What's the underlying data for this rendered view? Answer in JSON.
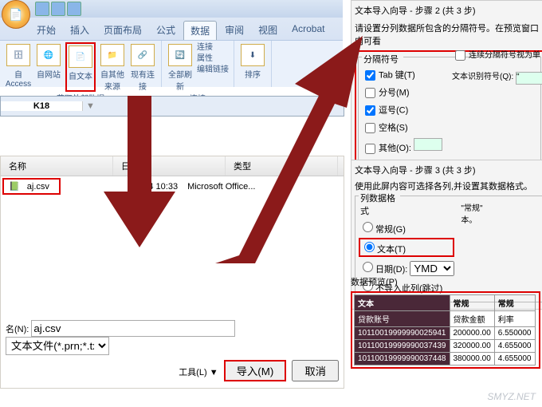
{
  "ribbon": {
    "tabs": [
      "开始",
      "插入",
      "页面布局",
      "公式",
      "数据",
      "审阅",
      "视图",
      "Acrobat"
    ],
    "active": 4,
    "group1": {
      "btns": [
        "自 Access",
        "自网站",
        "自文本",
        "自其他来源"
      ],
      "label": "获取外部数据"
    },
    "group1b": {
      "btn": "现有连接"
    },
    "group2": {
      "btn": "全部刷新",
      "items": [
        "连接",
        "属性",
        "编辑链接"
      ],
      "label": "连接"
    },
    "group3": {
      "btn": "排序"
    }
  },
  "namebox": {
    "cell": "K18"
  },
  "fileopen": {
    "headers": [
      "名称",
      "日期",
      "类型"
    ],
    "row": {
      "name": "aj.csv",
      "date": "0/3/14 10:33",
      "type": "Microsoft Office..."
    },
    "namelabel": "名(N):",
    "filter": "文本文件(*.prn;*.txt;*.csv)",
    "tools": "工具(L)",
    "import": "导入(M)",
    "cancel": "取消"
  },
  "wiz2": {
    "title": "文本导入向导 - 步骤 2 (共 3 步)",
    "desc": "请设置分列数据所包含的分隔符号。在预览窗口内可看",
    "fs": "分隔符号",
    "opts": [
      "Tab 键(T)",
      "分号(M)",
      "逗号(C)",
      "空格(S)",
      "其他(O):"
    ],
    "checked": [
      true,
      false,
      true,
      false,
      false
    ],
    "chain": "连续分隔符号视为单",
    "txtid": "文本识别符号(Q):",
    "prev": "数据预览(P)"
  },
  "wiz3": {
    "title": "文本导入向导 - 步骤 3 (共 3 步)",
    "desc": "使用此屏内容可选择各列,并设置其数据格式。",
    "fs": "列数据格式",
    "opts": [
      "常规(G)",
      "文本(T)",
      "日期(D):",
      "不导入此列(跳过)"
    ],
    "sel": 1,
    "ymd": "YMD",
    "note1": "\"常规\"",
    "note2": "本。"
  },
  "preview": {
    "label": "数据预览(P)",
    "hdr": [
      "文本",
      "常规",
      "常规"
    ],
    "sub": [
      "贷款账号",
      "贷款金额",
      "利率"
    ],
    "rows": [
      [
        "10110019999990025941",
        "200000.00",
        "6.550000"
      ],
      [
        "10110019999990037439",
        "320000.00",
        "4.655000"
      ],
      [
        "10110019999990037448",
        "380000.00",
        "4.655000"
      ]
    ]
  },
  "watermark": "SMYZ.NET"
}
